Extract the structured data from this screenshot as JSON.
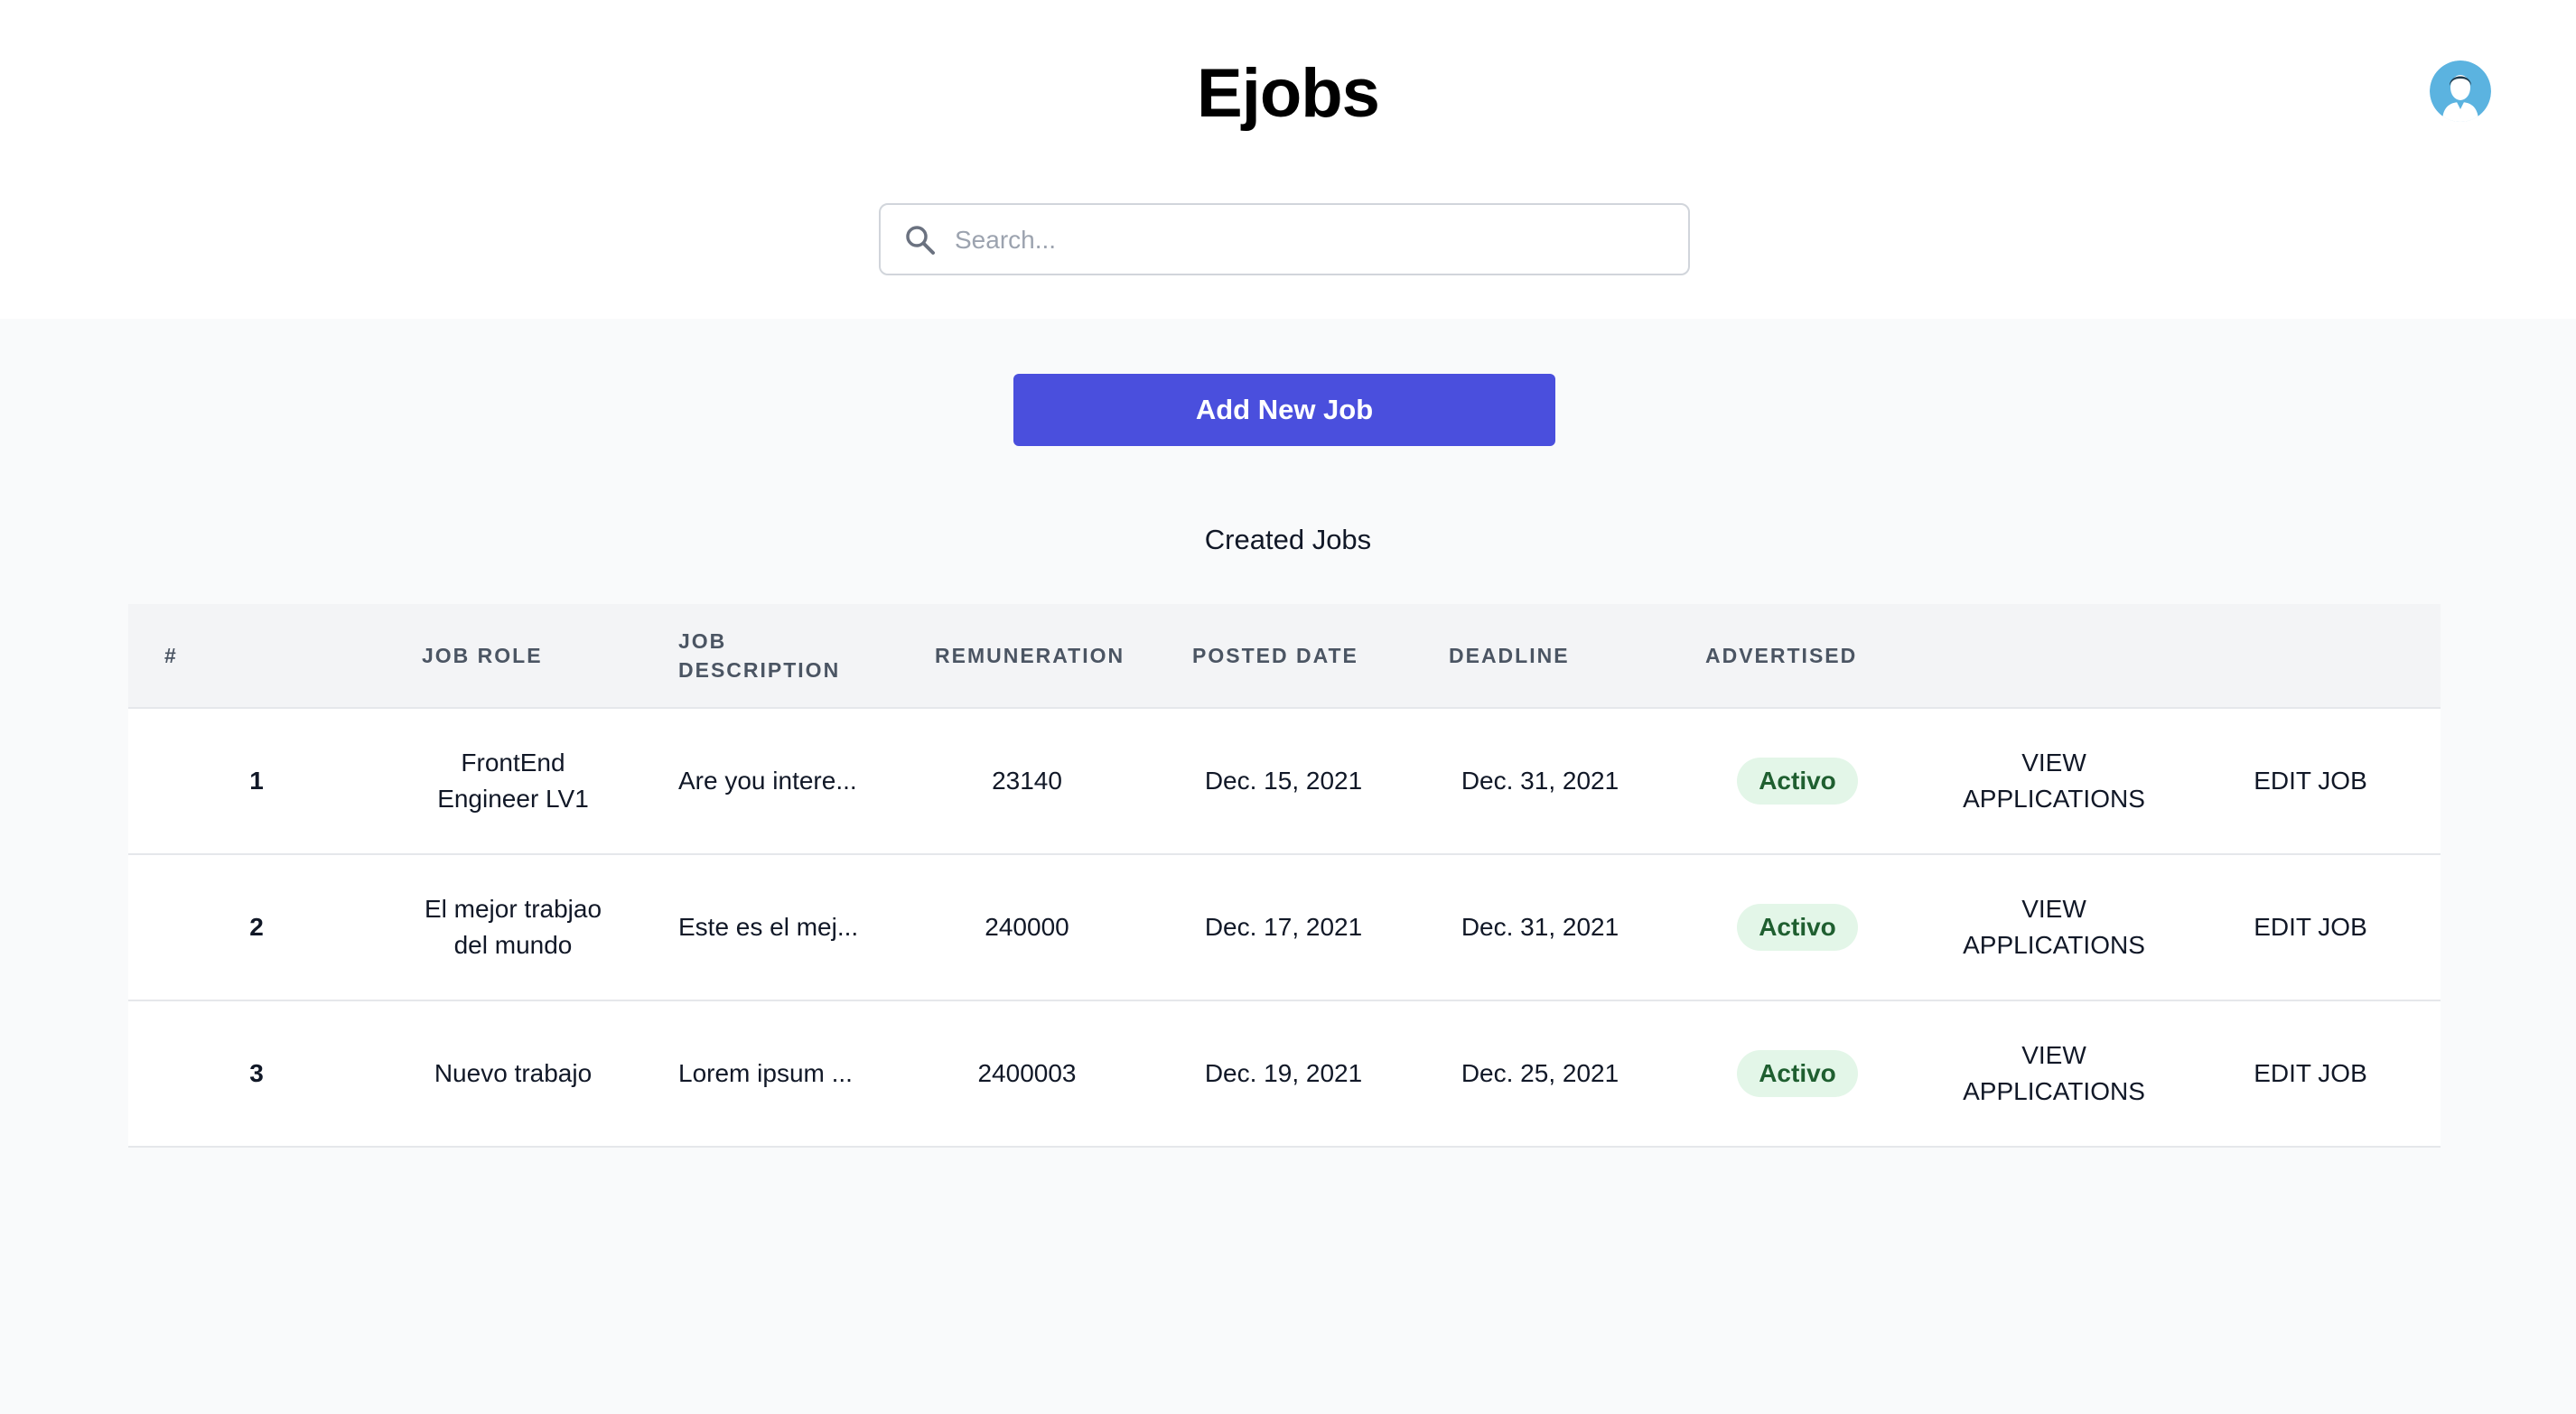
{
  "app": {
    "title": "Ejobs"
  },
  "search": {
    "placeholder": "Search...",
    "value": ""
  },
  "actions": {
    "add_job_label": "Add New Job"
  },
  "section": {
    "title": "Created Jobs"
  },
  "table": {
    "headers": {
      "index": "#",
      "job_role": "JOB ROLE",
      "job_description_line1": "JOB",
      "job_description_line2": "DESCRIPTION",
      "remuneration": "REMUNERATION",
      "posted_date": "POSTED DATE",
      "deadline": "DEADLINE",
      "advertised": "ADVERTISED"
    },
    "rows": [
      {
        "index": "1",
        "job_role_line1": "FrontEnd",
        "job_role_line2": "Engineer LV1",
        "description": "Are you intere...",
        "remuneration": "23140",
        "posted_date": "Dec. 15, 2021",
        "deadline": "Dec. 31, 2021",
        "status": "Activo",
        "view_line1": "VIEW",
        "view_line2": "APPLICATIONS",
        "edit": "EDIT JOB"
      },
      {
        "index": "2",
        "job_role_line1": "El mejor trabjao",
        "job_role_line2": "del mundo",
        "description": "Este es el mej...",
        "remuneration": "240000",
        "posted_date": "Dec. 17, 2021",
        "deadline": "Dec. 31, 2021",
        "status": "Activo",
        "view_line1": "VIEW",
        "view_line2": "APPLICATIONS",
        "edit": "EDIT JOB"
      },
      {
        "index": "3",
        "job_role_line1": "Nuevo trabajo",
        "job_role_line2": "",
        "description": "Lorem ipsum ...",
        "remuneration": "2400003",
        "posted_date": "Dec. 19, 2021",
        "deadline": "Dec. 25, 2021",
        "status": "Activo",
        "view_line1": "VIEW",
        "view_line2": "APPLICATIONS",
        "edit": "EDIT JOB"
      }
    ]
  },
  "icons": {
    "search": "search-icon",
    "avatar": "user-avatar-icon"
  },
  "colors": {
    "accent": "#4a4fdd",
    "status_bg": "#e3f6e8",
    "status_text": "#1f5f30",
    "page_bg": "#f9fafb",
    "header_bg": "#f3f4f6"
  }
}
